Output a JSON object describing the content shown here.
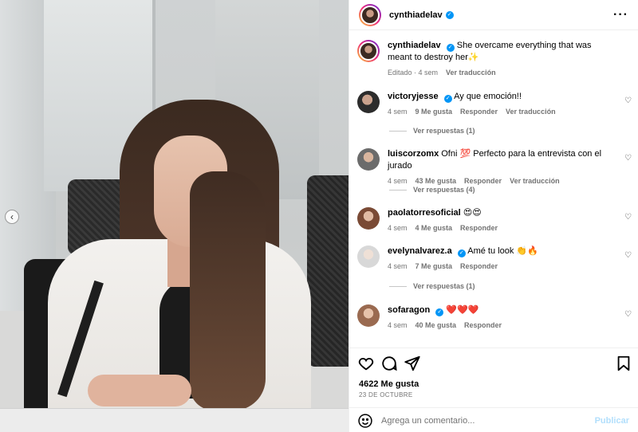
{
  "post_user": "cynthiadelav",
  "caption": {
    "username": "cynthiadelav",
    "text": "She overcame everything that was meant to destroy her",
    "emoji": "✨",
    "edited": "Editado",
    "time": "4 sem",
    "translate": "Ver traducción"
  },
  "comments": [
    {
      "username": "victoryjesse",
      "text": "Ay que emoción!!",
      "time": "4 sem",
      "likes": "9 Me gusta",
      "reply": "Responder",
      "translate": "Ver traducción",
      "replies": "Ver respuestas (1)"
    },
    {
      "username": "luiscorzomx",
      "text": "Ofni 💯 Perfecto para la entrevista con el jurado",
      "time": "4 sem",
      "likes": "43 Me gusta",
      "reply": "Responder",
      "translate": "Ver traducción",
      "replies": "Ver respuestas (4)"
    },
    {
      "username": "paolatorresoficial",
      "text": "😍😍",
      "time": "4 sem",
      "likes": "4 Me gusta",
      "reply": "Responder"
    },
    {
      "username": "evelynalvarez.a",
      "text": "Amé tu look 👏🔥",
      "time": "4 sem",
      "likes": "7 Me gusta",
      "reply": "Responder",
      "replies": "Ver respuestas (1)"
    },
    {
      "username": "sofaragon",
      "text": "❤️❤️❤️",
      "time": "4 sem",
      "likes": "40 Me gusta",
      "reply": "Responder"
    }
  ],
  "likes_total": "4622 Me gusta",
  "date": "23 DE OCTUBRE",
  "comment_placeholder": "Agrega un comentario...",
  "publish": "Publicar",
  "icons": {
    "more": "more-options-icon",
    "like": "heart-icon",
    "comment": "comment-icon",
    "share": "share-icon",
    "save": "bookmark-icon",
    "emoji": "emoji-icon",
    "prev": "chevron-left-icon"
  },
  "colors": {
    "accent": "#0095f6",
    "publish_disabled": "#b2dffc",
    "muted": "#737373"
  }
}
